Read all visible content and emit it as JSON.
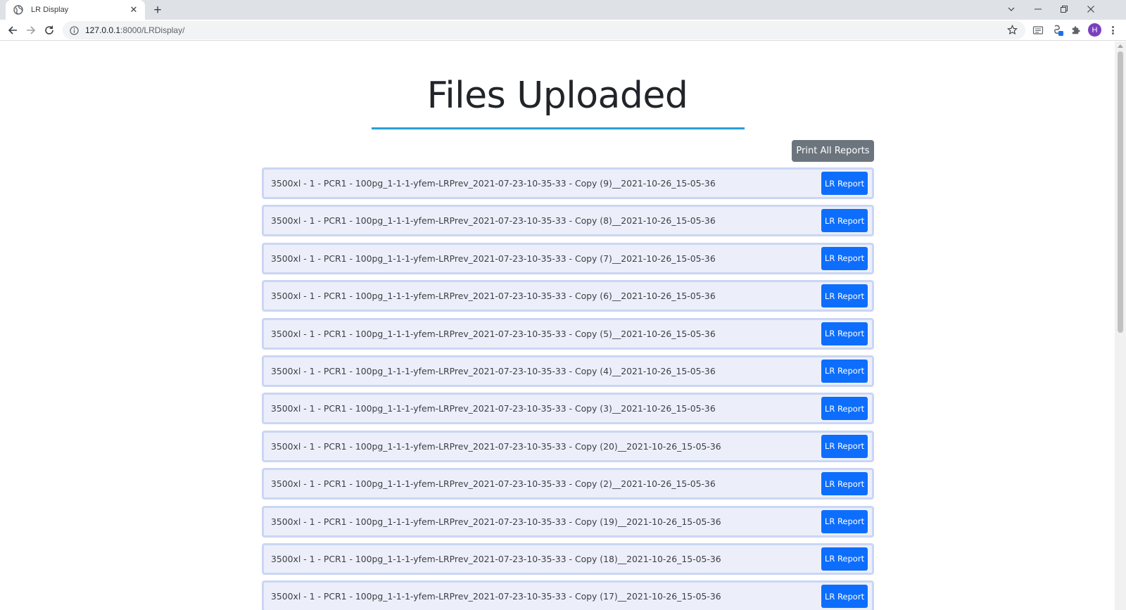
{
  "browser": {
    "tab_title": "LR Display",
    "url_host": "127.0.0.1",
    "url_rest": ":8000/LRDisplay/",
    "new_tab": "+",
    "tab_close": "✕",
    "profile_initial": "H"
  },
  "page": {
    "title": "Files Uploaded",
    "print_all_label": "Print All Reports",
    "report_button_label": "LR Report",
    "files": [
      "3500xl - 1 - PCR1 - 100pg_1-1-1-yfem-LRPrev_2021-07-23-10-35-33 - Copy (9)__2021-10-26_15-05-36",
      "3500xl - 1 - PCR1 - 100pg_1-1-1-yfem-LRPrev_2021-07-23-10-35-33 - Copy (8)__2021-10-26_15-05-36",
      "3500xl - 1 - PCR1 - 100pg_1-1-1-yfem-LRPrev_2021-07-23-10-35-33 - Copy (7)__2021-10-26_15-05-36",
      "3500xl - 1 - PCR1 - 100pg_1-1-1-yfem-LRPrev_2021-07-23-10-35-33 - Copy (6)__2021-10-26_15-05-36",
      "3500xl - 1 - PCR1 - 100pg_1-1-1-yfem-LRPrev_2021-07-23-10-35-33 - Copy (5)__2021-10-26_15-05-36",
      "3500xl - 1 - PCR1 - 100pg_1-1-1-yfem-LRPrev_2021-07-23-10-35-33 - Copy (4)__2021-10-26_15-05-36",
      "3500xl - 1 - PCR1 - 100pg_1-1-1-yfem-LRPrev_2021-07-23-10-35-33 - Copy (3)__2021-10-26_15-05-36",
      "3500xl - 1 - PCR1 - 100pg_1-1-1-yfem-LRPrev_2021-07-23-10-35-33 - Copy (20)__2021-10-26_15-05-36",
      "3500xl - 1 - PCR1 - 100pg_1-1-1-yfem-LRPrev_2021-07-23-10-35-33 - Copy (2)__2021-10-26_15-05-36",
      "3500xl - 1 - PCR1 - 100pg_1-1-1-yfem-LRPrev_2021-07-23-10-35-33 - Copy (19)__2021-10-26_15-05-36",
      "3500xl - 1 - PCR1 - 100pg_1-1-1-yfem-LRPrev_2021-07-23-10-35-33 - Copy (18)__2021-10-26_15-05-36",
      "3500xl - 1 - PCR1 - 100pg_1-1-1-yfem-LRPrev_2021-07-23-10-35-33 - Copy (17)__2021-10-26_15-05-36"
    ]
  },
  "colors": {
    "title_underline": "#2a9fd8",
    "print_button": "#6c757d",
    "report_button": "#0d6efd",
    "row_background": "#eceff9",
    "row_border": "#cad6f5"
  },
  "icons": [
    "globe-icon",
    "close-icon",
    "plus-icon",
    "chevron-down-icon",
    "minimize-icon",
    "restore-icon",
    "back-arrow-icon",
    "forward-arrow-icon",
    "reload-icon",
    "info-icon",
    "star-icon",
    "screenshot-icon",
    "sync-icon",
    "puzzle-icon",
    "kebab-menu-icon"
  ]
}
